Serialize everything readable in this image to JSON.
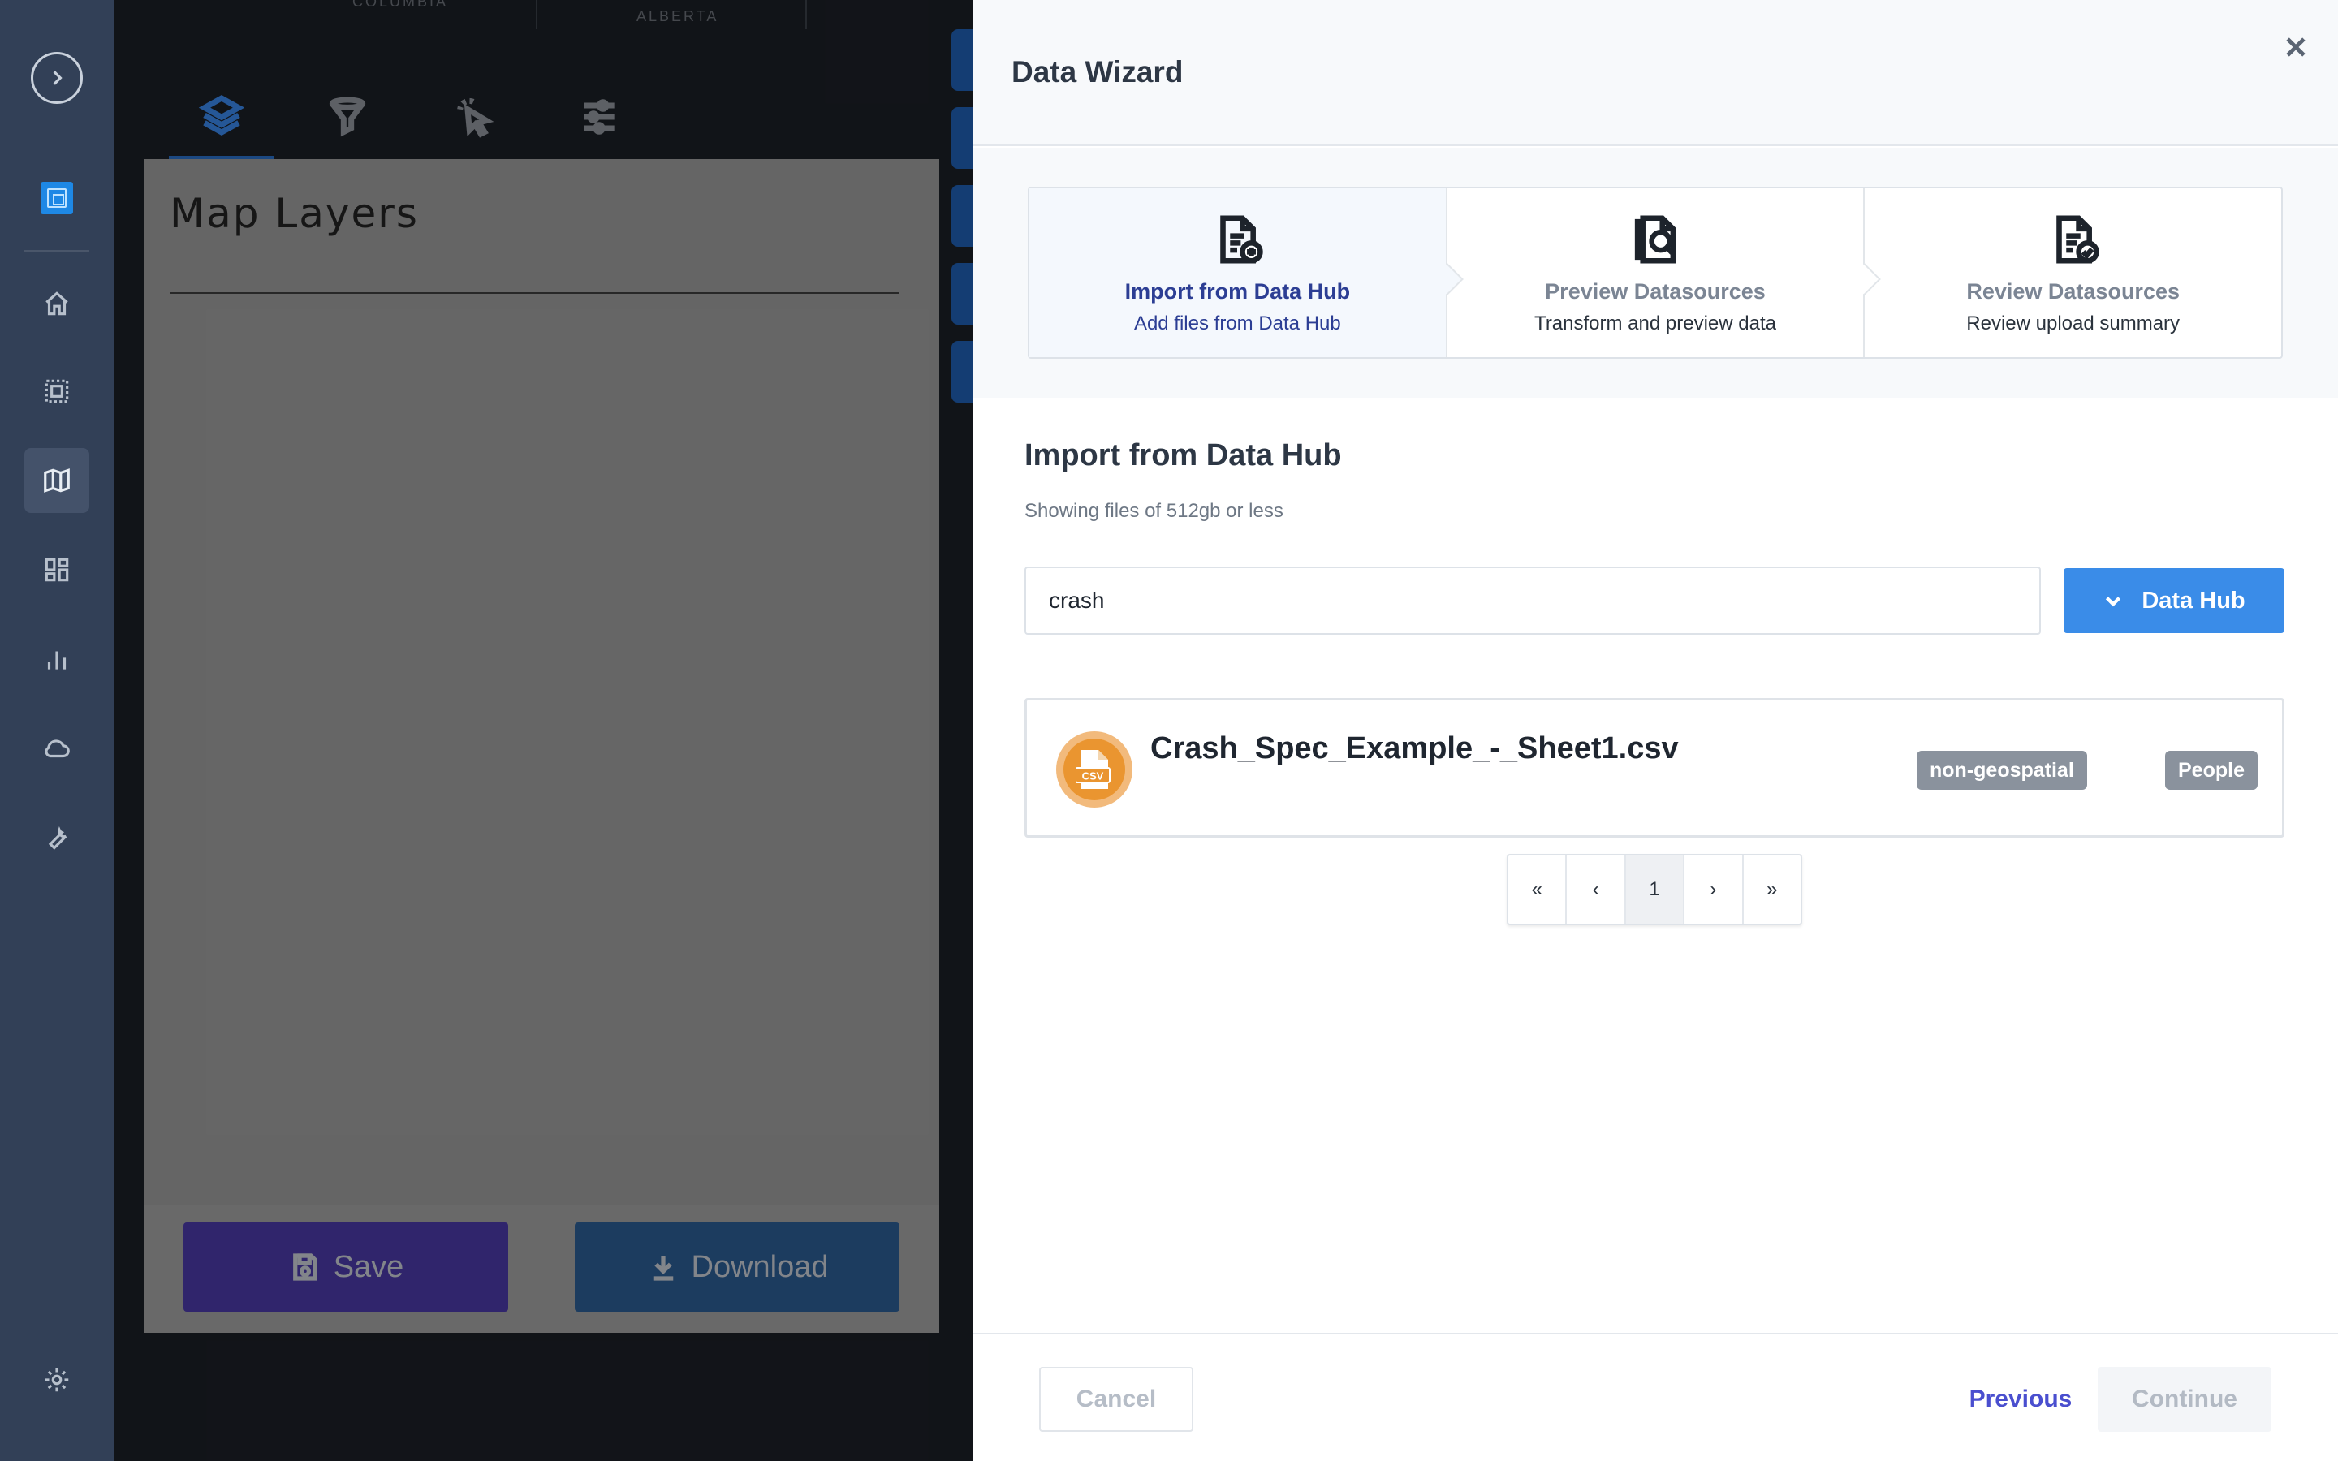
{
  "rail": {
    "items": [
      "expand",
      "app-logo",
      "home",
      "selection",
      "map",
      "dashboard",
      "bar-chart",
      "cloud",
      "tools",
      "settings"
    ]
  },
  "map": {
    "labels": [
      "COLUMBIA",
      "ALBERTA"
    ]
  },
  "layers_panel": {
    "tabs": [
      "layers-icon",
      "filter-icon",
      "select-pointer-icon",
      "sliders-icon"
    ],
    "title": "Map Layers",
    "save_label": "Save",
    "download_label": "Download"
  },
  "wizard": {
    "title": "Data Wizard",
    "steps": [
      {
        "title": "Import from Data Hub",
        "subtitle": "Add files from Data Hub",
        "icon": "file-add-icon",
        "active": true
      },
      {
        "title": "Preview Datasources",
        "subtitle": "Transform and preview data",
        "icon": "file-search-icon",
        "active": false
      },
      {
        "title": "Review Datasources",
        "subtitle": "Review upload summary",
        "icon": "file-check-icon",
        "active": false
      }
    ],
    "section_title": "Import from Data Hub",
    "section_subtitle": "Showing files of 512gb or less",
    "search_value": "crash",
    "datahub_button": "Data Hub",
    "files": [
      {
        "name": "Crash_Spec_Example_-_Sheet1.csv",
        "icon_text": "CSV",
        "tags": [
          "non-geospatial",
          "People"
        ]
      }
    ],
    "pager": {
      "first": "«",
      "prev": "‹",
      "page": "1",
      "next": "›",
      "last": "»"
    },
    "footer": {
      "cancel": "Cancel",
      "previous": "Previous",
      "continue": "Continue"
    }
  },
  "colors": {
    "rail": "#324057",
    "primary_blue": "#3a8ce8",
    "save_purple": "#4b3aa6",
    "previous_link": "#4a4fcf",
    "csv_orange": "#ea9530"
  }
}
